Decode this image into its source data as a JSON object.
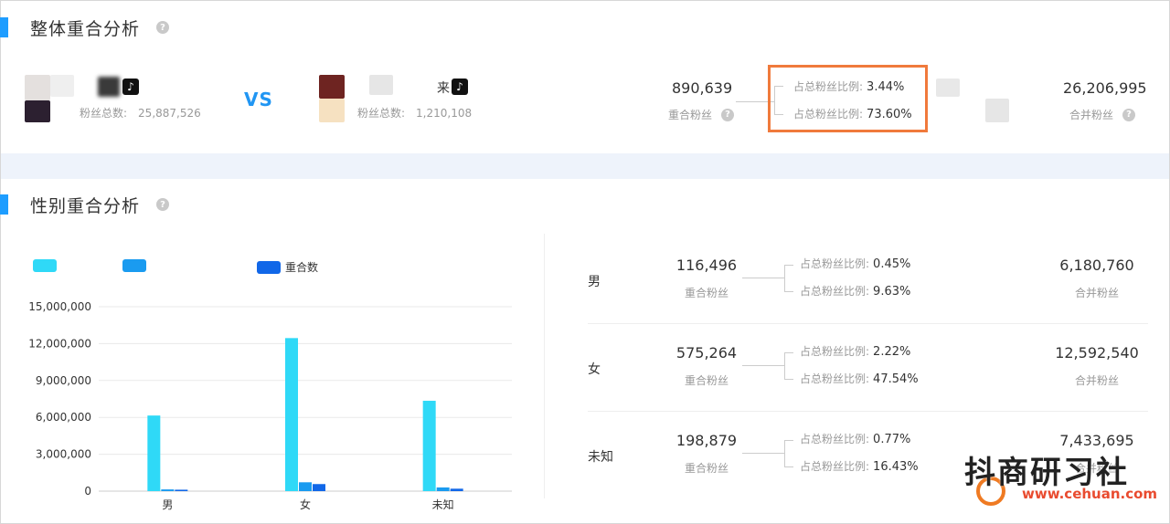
{
  "overall": {
    "title": "整体重合分析",
    "account_a": {
      "fans_label": "粉丝总数:",
      "fans_value": "25,887,526"
    },
    "vs": "VS",
    "account_b": {
      "name_fragment": "来",
      "fans_label": "粉丝总数:",
      "fans_value": "1,210,108"
    },
    "overlap": {
      "value": "890,639",
      "label": "重合粉丝"
    },
    "ratios": [
      {
        "label": "占总粉丝比例:",
        "value": "3.44%"
      },
      {
        "label": "占总粉丝比例:",
        "value": "73.60%"
      }
    ],
    "merged": {
      "value": "26,206,995",
      "label": "合并粉丝"
    }
  },
  "gender": {
    "title": "性别重合分析",
    "legend": [
      {
        "label": "",
        "color": "#2fd9f7"
      },
      {
        "label": "",
        "color": "#1a9bf0"
      },
      {
        "label": "重合数",
        "color": "#1167e8"
      }
    ],
    "rows": [
      {
        "label": "男",
        "overlap": "116,496",
        "overlap_label": "重合粉丝",
        "ratio_a_label": "占总粉丝比例:",
        "ratio_a": "0.45%",
        "ratio_b_label": "占总粉丝比例:",
        "ratio_b": "9.63%",
        "merged": "6,180,760",
        "merged_label": "合并粉丝"
      },
      {
        "label": "女",
        "overlap": "575,264",
        "overlap_label": "重合粉丝",
        "ratio_a_label": "占总粉丝比例:",
        "ratio_a": "2.22%",
        "ratio_b_label": "占总粉丝比例:",
        "ratio_b": "47.54%",
        "merged": "12,592,540",
        "merged_label": "合并粉丝"
      },
      {
        "label": "未知",
        "overlap": "198,879",
        "overlap_label": "重合粉丝",
        "ratio_a_label": "占总粉丝比例:",
        "ratio_a": "0.77%",
        "ratio_b_label": "占总粉丝比例:",
        "ratio_b": "16.43%",
        "merged": "7,433,695",
        "merged_label": "合并粉丝"
      }
    ]
  },
  "chart_data": {
    "type": "bar",
    "categories": [
      "男",
      "女",
      "未知"
    ],
    "series": [
      {
        "values": [
          6150000,
          12450000,
          7350000
        ],
        "color": "#2fd9f7"
      },
      {
        "values": [
          140000,
          720000,
          300000
        ],
        "color": "#1a9bf0"
      },
      {
        "name": "重合数",
        "values": [
          116496,
          575264,
          198879
        ],
        "color": "#1167e8"
      }
    ],
    "yticks": [
      "0",
      "3,000,000",
      "6,000,000",
      "9,000,000",
      "12,000,000",
      "15,000,000"
    ],
    "ylim": [
      0,
      15000000
    ],
    "grid": true,
    "legend_position": "top-left"
  },
  "watermark": {
    "text": "抖商研习社",
    "url": "www.cehuan.com"
  }
}
